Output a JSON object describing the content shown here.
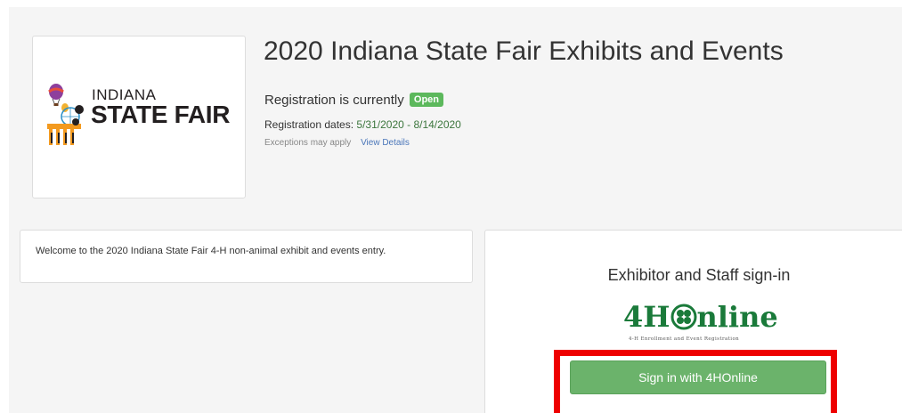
{
  "event": {
    "title": "2020 Indiana State Fair Exhibits and Events",
    "logo": {
      "small_text": "INDIANA",
      "big_text": "STATE FAIR",
      "icon": "balloons-ferris-wheel-logo-icon"
    }
  },
  "registration": {
    "status_prefix": "Registration is currently",
    "status_badge": "Open",
    "dates_label": "Registration dates:",
    "dates_value": "5/31/2020 - 8/14/2020",
    "exceptions_text": "Exceptions may apply",
    "view_details_link": "View Details"
  },
  "welcome": {
    "text": "Welcome to the 2020 Indiana State Fair 4-H non-animal exhibit and events entry."
  },
  "signin": {
    "heading": "Exhibitor and Staff sign-in",
    "fourh_logo_left": "4H",
    "fourh_logo_right": "nline",
    "fourh_tagline": "4-H Enrollment and Event Registration",
    "button_label": "Sign in with 4HOnline"
  },
  "colors": {
    "badge_green": "#5cb85c",
    "button_green": "#6bb36b",
    "dates_green": "#3c763d",
    "link_blue": "#4a76b9",
    "highlight_red": "#ee0000",
    "fourh_green": "#1a7a3a"
  }
}
